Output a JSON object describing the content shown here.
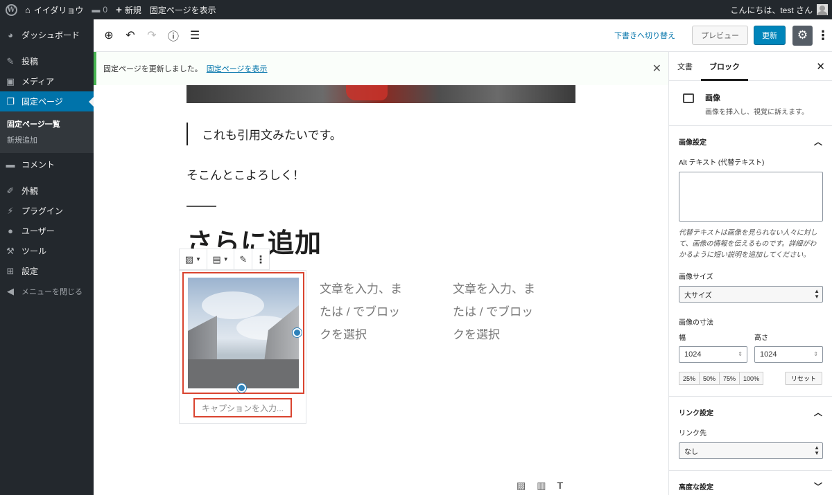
{
  "adminbar": {
    "site_name": "イイダリョウ",
    "comments_count": "0",
    "new_label": "新規",
    "view_page": "固定ページを表示",
    "greeting": "こんにちは、test さん"
  },
  "menu": {
    "dashboard": "ダッシュボード",
    "posts": "投稿",
    "media": "メディア",
    "pages": "固定ページ",
    "pages_list": "固定ページ一覧",
    "add_new": "新規追加",
    "comments": "コメント",
    "appearance": "外観",
    "plugins": "プラグイン",
    "users": "ユーザー",
    "tools": "ツール",
    "settings": "設定",
    "collapse": "メニューを閉じる"
  },
  "header": {
    "switch_to_draft": "下書きへ切り替え",
    "preview": "プレビュー",
    "update": "更新"
  },
  "notice": {
    "message": "固定ページを更新しました。",
    "link": "固定ページを表示"
  },
  "content": {
    "quote": "これも引用文みたいです。",
    "paragraph": "そこんとこよろしく！",
    "heading": "さらに追加",
    "caption_placeholder": "キャプションを入力...",
    "col2_text": [
      "文章を入力、ま",
      "たは / でブロッ",
      "クを選択"
    ],
    "col3_text": [
      "文章を入力、ま",
      "たは / でブロッ",
      "クを選択"
    ]
  },
  "sidebar": {
    "tab_document": "文書",
    "tab_block": "ブロック",
    "block_title": "画像",
    "block_desc": "画像を挿入し、視覚に訴えます。",
    "image_settings": "画像設定",
    "alt_label": "Alt テキスト (代替テキスト)",
    "alt_help": "代替テキストは画像を見られない人々に対して、画像の情報を伝えるものです。詳細がわかるように短い説明を追加してください。",
    "image_size_label": "画像サイズ",
    "image_size_value": "大サイズ",
    "dimensions_label": "画像の寸法",
    "width_label": "幅",
    "height_label": "高さ",
    "width_value": "1024",
    "height_value": "1024",
    "pct": [
      "25%",
      "50%",
      "75%",
      "100%"
    ],
    "reset": "リセット",
    "link_settings": "リンク設定",
    "link_to_label": "リンク先",
    "link_to_value": "なし",
    "advanced": "高度な設定"
  },
  "colors": {
    "admin_bg": "#23282d",
    "accent": "#0073aa",
    "update_btn": "#0085ba",
    "selection_outline": "#d9432f",
    "notice_border": "#46b450"
  }
}
